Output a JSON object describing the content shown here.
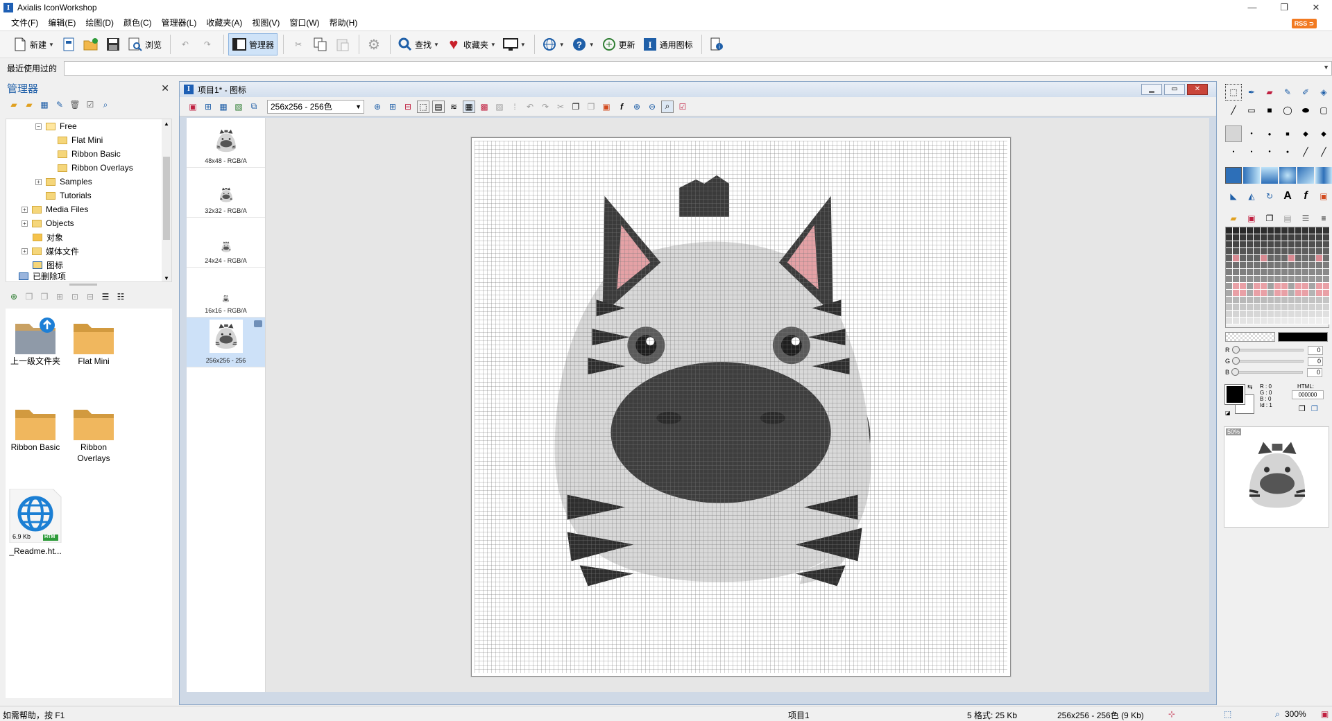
{
  "window": {
    "title": "Axialis IconWorkshop",
    "logo_letter": "I"
  },
  "menu": [
    "文件(F)",
    "编辑(E)",
    "绘图(D)",
    "颜色(C)",
    "管理器(L)",
    "收藏夹(A)",
    "视图(V)",
    "窗口(W)",
    "帮助(H)"
  ],
  "rss_label": "RSS",
  "toolbar": {
    "new": "新建",
    "browse": "浏览",
    "manager": "管理器",
    "find": "查找",
    "favorites": "收藏夹",
    "update": "更新",
    "universal_icon": "通用图标"
  },
  "recent": {
    "label": "最近使用过的",
    "value": ""
  },
  "manager": {
    "title": "管理器",
    "tree": [
      {
        "label": "Free",
        "level": 2,
        "expanded": true
      },
      {
        "label": "Flat Mini",
        "level": 3
      },
      {
        "label": "Ribbon Basic",
        "level": 3
      },
      {
        "label": "Ribbon Overlays",
        "level": 3
      },
      {
        "label": "Samples",
        "level": 2,
        "collapsed": true
      },
      {
        "label": "Tutorials",
        "level": 2
      },
      {
        "label": "Media Files",
        "level": 1,
        "collapsed": true
      },
      {
        "label": "Objects",
        "level": 1,
        "collapsed": true
      },
      {
        "label": "对象",
        "level": 1
      },
      {
        "label": "媒体文件",
        "level": 1,
        "collapsed": true
      },
      {
        "label": "图标",
        "level": 1
      },
      {
        "label": "已删除项",
        "level": 0
      }
    ],
    "files": [
      {
        "name": "上一级文件夹"
      },
      {
        "name": "Flat Mini"
      },
      {
        "name": "Ribbon Basic"
      },
      {
        "name": "Ribbon Overlays"
      },
      {
        "name": "_Readme.ht...",
        "size": "6.9 Kb",
        "badge": "HTM"
      }
    ]
  },
  "document": {
    "title": "项目1* - 图标",
    "format_select": "256x256 - 256色",
    "formats": [
      {
        "label": "48x48 - RGB/A"
      },
      {
        "label": "32x32 - RGB/A"
      },
      {
        "label": "24x24 - RGB/A"
      },
      {
        "label": "16x16 - RGB/A"
      },
      {
        "label": "256x256 - 256",
        "selected": true
      }
    ]
  },
  "colors": {
    "R": "0",
    "G": "0",
    "B": "0",
    "info_r": "R : 0",
    "info_g": "G : 0",
    "info_b": "B : 0",
    "info_id": "Id : 1",
    "html_label": "HTML:",
    "html_value": "000000",
    "preview_zoom": "50%",
    "accent": "#1f5fa8",
    "selection": "#cde1f8"
  },
  "status": {
    "help": "如需帮助，按 F1",
    "project": "项目1",
    "formats": "5 格式:   25 Kb",
    "size": "256x256 - 256色 (9 Kb)",
    "zoom": "300%"
  }
}
